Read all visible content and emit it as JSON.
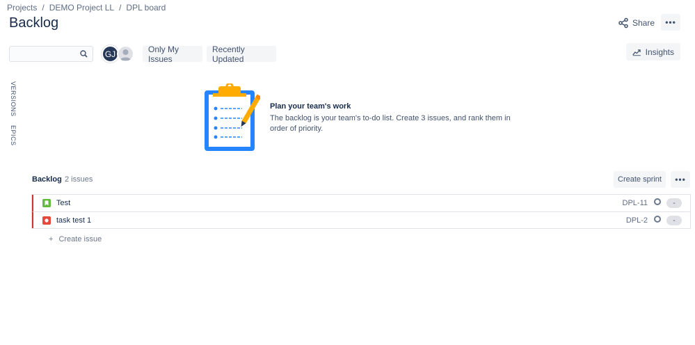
{
  "breadcrumb": {
    "items": [
      "Projects",
      "DEMO Project LL",
      "DPL board"
    ],
    "separator": "/"
  },
  "page": {
    "title": "Backlog"
  },
  "header": {
    "share_label": "Share",
    "more_label": "•••"
  },
  "toolbar": {
    "search_placeholder": "",
    "avatar_initials": "GJ",
    "filters": [
      "Only My Issues",
      "Recently Updated"
    ],
    "insights_label": "Insights"
  },
  "sidebar": {
    "tabs": [
      "VERSIONS",
      "EPICS"
    ]
  },
  "empty_state": {
    "title": "Plan your team's work",
    "description": "The backlog is your team's to-do list. Create 3 issues, and rank them in order of priority."
  },
  "backlog": {
    "label": "Backlog",
    "count": "2 issues",
    "create_sprint_label": "Create sprint",
    "more_label": "•••",
    "issues": [
      {
        "type": "story",
        "summary": "Test",
        "key": "DPL-11",
        "estimate": "-"
      },
      {
        "type": "bug",
        "summary": "task test 1",
        "key": "DPL-2",
        "estimate": "-"
      }
    ],
    "create_issue_label": "Create issue",
    "create_issue_prefix": "+"
  },
  "colors": {
    "accent": "#0052cc",
    "story": "#63ba3c",
    "bug": "#e5493a",
    "rank_bar": "#c9372c",
    "avatar_bg": "#253858"
  }
}
